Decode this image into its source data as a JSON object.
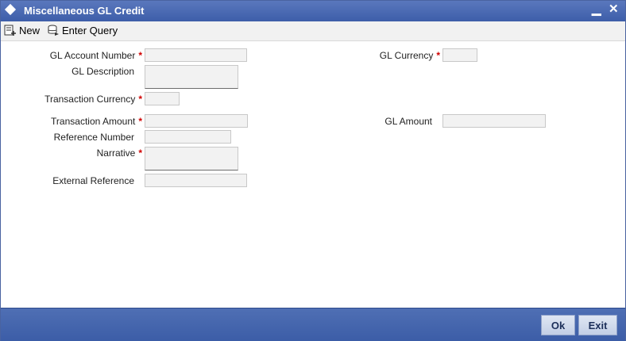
{
  "window": {
    "title": "Miscellaneous GL Credit",
    "minimize_glyph": "▁",
    "close_glyph": "✕"
  },
  "toolbar": {
    "new_label": "New",
    "new_icon": "new-doc-icon",
    "enter_query_label": "Enter Query",
    "enter_query_icon": "query-db-icon"
  },
  "form": {
    "gl_account_number": {
      "label": "GL Account Number",
      "required": "*",
      "value": ""
    },
    "gl_description": {
      "label": "GL Description",
      "value": ""
    },
    "transaction_currency": {
      "label": "Transaction Currency",
      "required": "*",
      "value": ""
    },
    "transaction_amount": {
      "label": "Transaction Amount",
      "required": "*",
      "value": ""
    },
    "reference_number": {
      "label": "Reference Number",
      "value": ""
    },
    "narrative": {
      "label": "Narrative",
      "required": "*",
      "value": ""
    },
    "external_reference": {
      "label": "External Reference",
      "value": ""
    },
    "gl_currency": {
      "label": "GL Currency",
      "required": "*",
      "value": ""
    },
    "gl_amount": {
      "label": "GL Amount",
      "value": ""
    }
  },
  "footer": {
    "ok_label": "Ok",
    "exit_label": "Exit"
  },
  "colors": {
    "titlebar": "#4a6bb5",
    "footer": "#4565ad",
    "required": "#d00000",
    "field_bg": "#f2f2f2"
  }
}
